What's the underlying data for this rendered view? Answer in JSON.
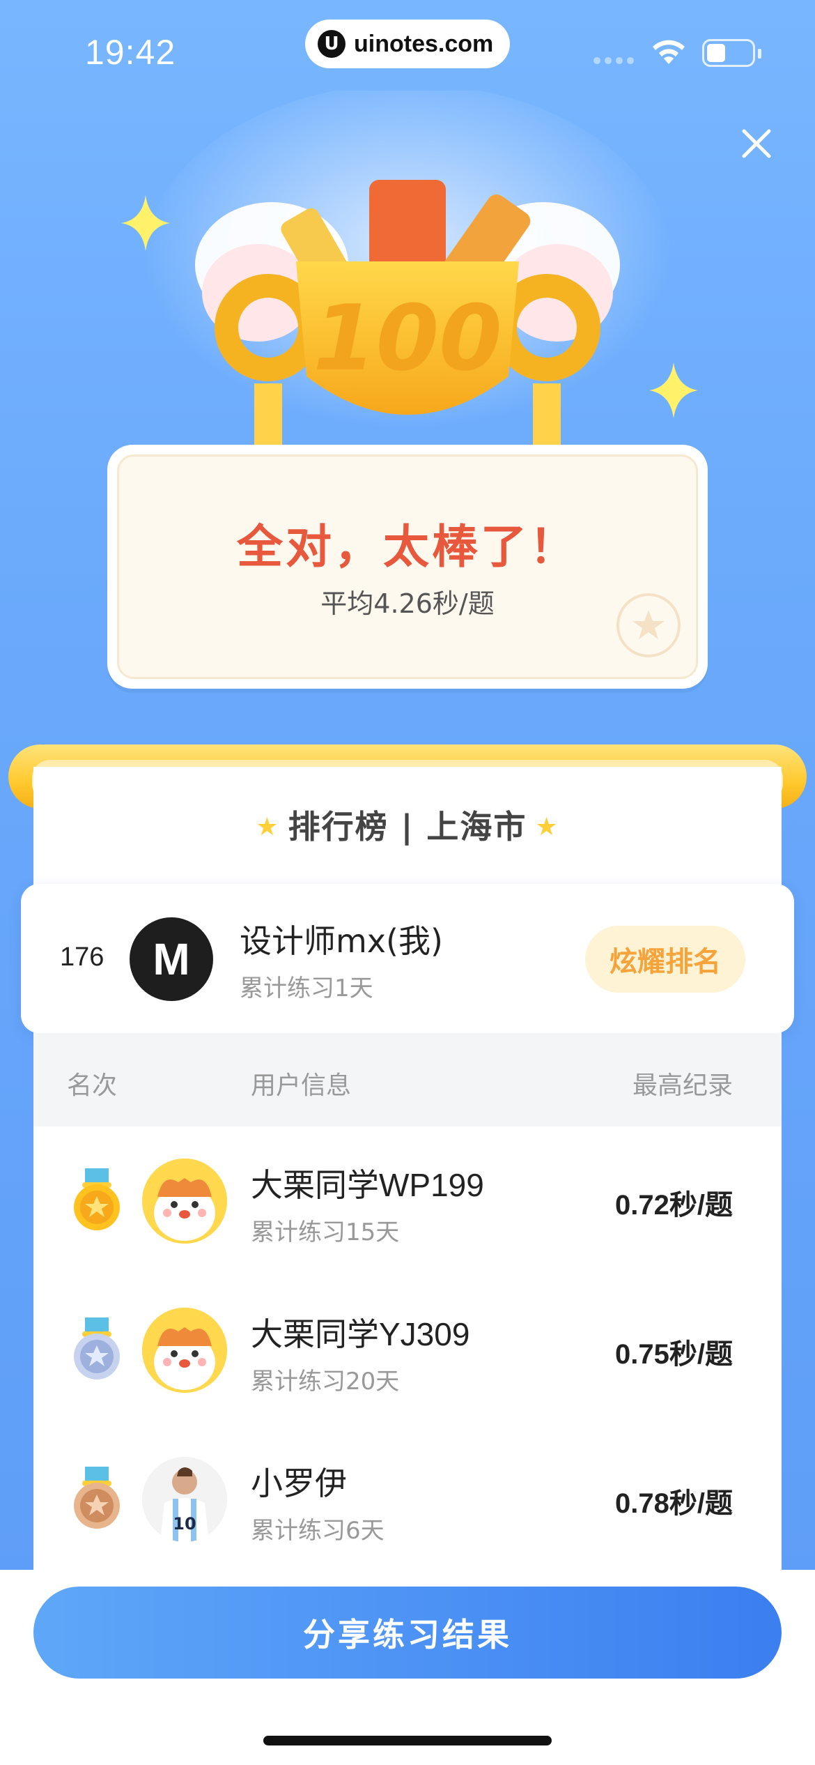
{
  "status_bar": {
    "time": "19:42",
    "url": "uinotes.com",
    "url_logo": "U"
  },
  "result": {
    "title": "全对，太棒了！",
    "subtitle": "平均4.26秒/题",
    "trophy_text": "100"
  },
  "leaderboard": {
    "title": "排行榜 | 上海市",
    "me": {
      "rank": "176",
      "avatar_text": "M",
      "name": "设计师mx(我)",
      "days": "累计练习1天",
      "brag_label": "炫耀排名"
    },
    "columns": {
      "rank": "名次",
      "user": "用户信息",
      "record": "最高纪录"
    },
    "rows": [
      {
        "medal": "gold",
        "name": "大栗同学WP199",
        "days": "累计练习15天",
        "record": "0.72秒/题",
        "avatar": "cat-mascot"
      },
      {
        "medal": "silver",
        "name": "大栗同学YJ309",
        "days": "累计练习20天",
        "record": "0.75秒/题",
        "avatar": "cat-mascot"
      },
      {
        "medal": "bronze",
        "name": "小罗伊",
        "days": "累计练习6天",
        "record": "0.78秒/题",
        "avatar": "football-player"
      }
    ]
  },
  "footer": {
    "share_label": "分享练习结果"
  },
  "colors": {
    "background": "#6aa9fb",
    "title_red": "#e8583c",
    "gold": "#ffc92e",
    "brag_text": "#f5a33a",
    "share_button": "#4a8ff4"
  }
}
